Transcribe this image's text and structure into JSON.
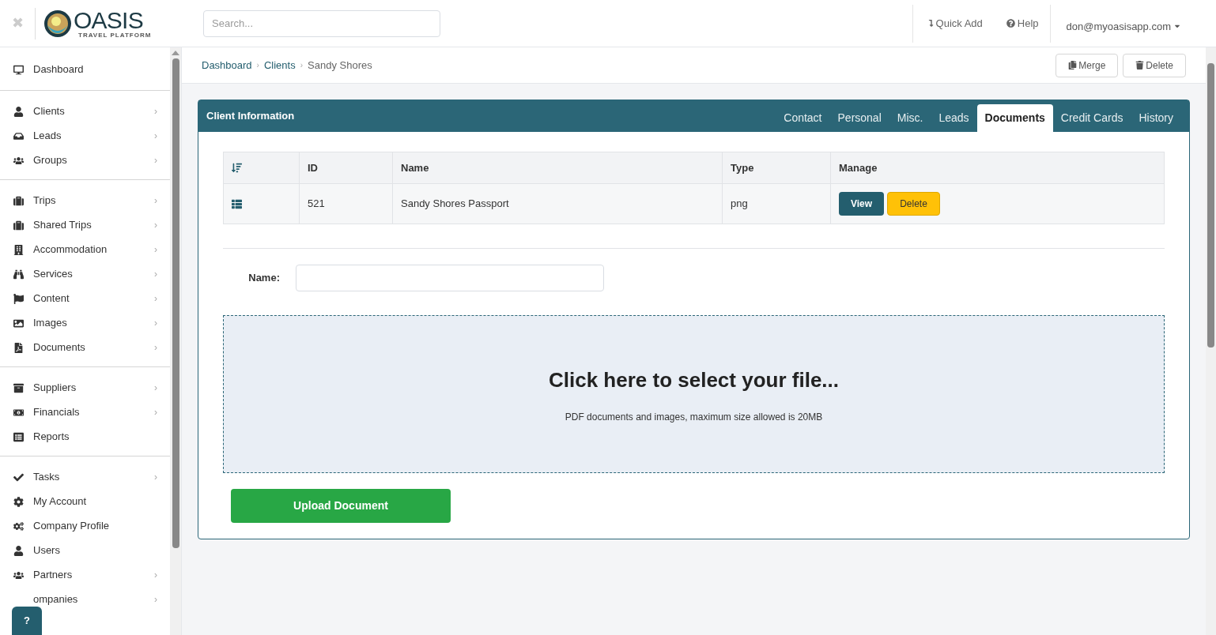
{
  "header": {
    "close": "✖",
    "logo": {
      "name": "OASIS",
      "tagline": "TRAVEL PLATFORM"
    },
    "search": {
      "placeholder": "Search..."
    },
    "quick_add": "Quick Add",
    "help": "Help",
    "user": "don@myoasisapp.com"
  },
  "sidebar": {
    "groups": [
      [
        {
          "label": "Dashboard"
        }
      ],
      [
        {
          "label": "Clients",
          "chevron": "›"
        },
        {
          "label": "Leads",
          "chevron": "›"
        },
        {
          "label": "Groups",
          "chevron": "›"
        }
      ],
      [
        {
          "label": "Trips",
          "chevron": "›"
        },
        {
          "label": "Shared Trips",
          "chevron": "›"
        },
        {
          "label": "Accommodation",
          "chevron": "›"
        },
        {
          "label": "Services",
          "chevron": "›"
        },
        {
          "label": "Content",
          "chevron": "›"
        },
        {
          "label": "Images",
          "chevron": "›"
        },
        {
          "label": "Documents",
          "chevron": "›"
        }
      ],
      [
        {
          "label": "Suppliers",
          "chevron": "›"
        },
        {
          "label": "Financials",
          "chevron": "›"
        },
        {
          "label": "Reports"
        }
      ],
      [
        {
          "label": "Tasks",
          "chevron": "›"
        },
        {
          "label": "My Account"
        },
        {
          "label": "Company Profile"
        },
        {
          "label": "Users"
        },
        {
          "label": "Partners",
          "chevron": "›"
        },
        {
          "label": "ompanies",
          "chevron": "›"
        }
      ]
    ],
    "help_button": "?"
  },
  "breadcrumb": [
    {
      "label": "Dashboard"
    },
    {
      "separator": "›",
      "label": "Clients"
    },
    {
      "separator": "›",
      "label": "Sandy Shores"
    }
  ],
  "actions": [
    "Merge",
    "Delete"
  ],
  "panel": {
    "title": "Client Information",
    "tabs": [
      {
        "label": "Contact",
        "selected": false
      },
      {
        "label": "Personal",
        "selected": false
      },
      {
        "label": "Misc.",
        "selected": false
      },
      {
        "label": "Leads",
        "selected": false
      },
      {
        "label": "Documents",
        "selected": true
      },
      {
        "label": "Credit Cards",
        "selected": false
      },
      {
        "label": "History",
        "selected": false
      }
    ],
    "table": {
      "columns": [
        "ID",
        "Name",
        "Type",
        "Manage"
      ],
      "rows": [
        {
          "id": "521",
          "name": "Sandy Shores Passport",
          "type": "png",
          "view": "View",
          "delete": "Delete"
        }
      ]
    },
    "name_label": "Name:",
    "dropzone": {
      "title": "Click here to select your file...",
      "hint": "PDF documents and images, maximum size allowed is 20MB"
    },
    "upload": "Upload Document"
  }
}
